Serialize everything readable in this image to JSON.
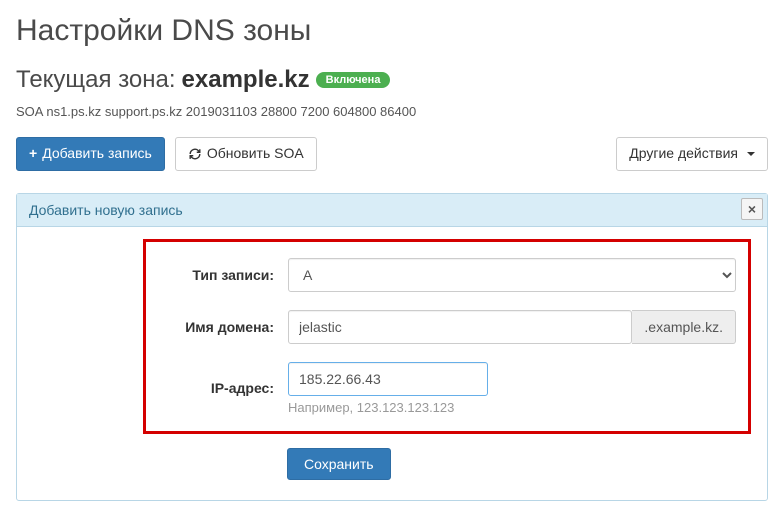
{
  "page": {
    "title": "Настройки DNS зоны",
    "current_zone_label": "Текущая зона:",
    "zone_name": "example.kz",
    "badge": "Включена",
    "soa": "SOA ns1.ps.kz support.ps.kz 2019031103 28800 7200 604800 86400"
  },
  "toolbar": {
    "add_record": "Добавить запись",
    "refresh_soa": "Обновить SOA",
    "other_actions": "Другие действия"
  },
  "panel": {
    "heading": "Добавить новую запись",
    "close": "×"
  },
  "form": {
    "type_label": "Тип записи:",
    "type_value": "A",
    "domain_label": "Имя домена:",
    "domain_value": "jelastic",
    "domain_suffix": ".example.kz.",
    "ip_label": "IP-адрес:",
    "ip_value": "185.22.66.43",
    "ip_hint": "Например, 123.123.123.123",
    "save": "Сохранить"
  }
}
